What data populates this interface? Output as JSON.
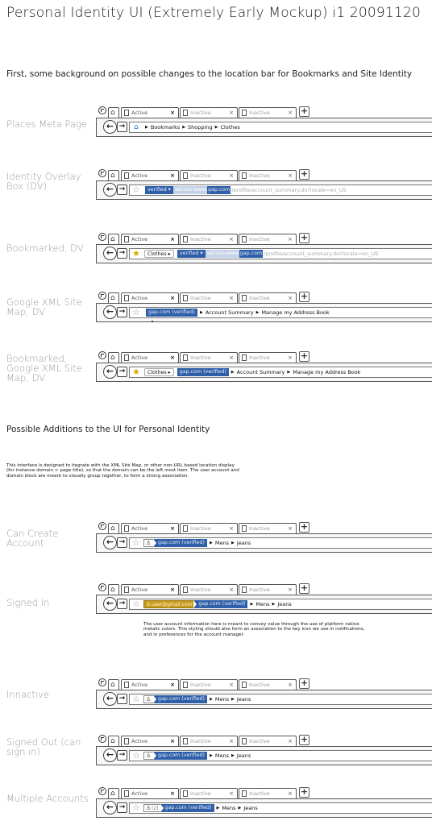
{
  "title": "Personal Identity UI (Extremely Early Mockup) i1 20091120",
  "section1_heading": "First, some background on possible changes to the location bar for Bookmarks and Site Identity",
  "section2_heading": "Possible Additions to the UI for Personal Identity",
  "intro_note": "This interface is designed to itegrate with the XML Site Map, or other non-URL based location display (for instance domain > page title), so that the domain can be the left most item. The user account and domain block are meant to visually group together, to form a strong association.",
  "signed_in_note": "The user account information here is meant to convey value through the use of platform native metalic colors. This styling should also form an association to the key icon we use in notifications, and in preferences for the account manager.",
  "tabs": {
    "active": "Active",
    "inactive": "Inactive",
    "close": "×",
    "new": "+"
  },
  "nav": {
    "back": "←",
    "forward": "→"
  },
  "rows": {
    "places": {
      "label": "Places Meta Page",
      "crumbs": [
        "Bookmarks",
        "Shopping",
        "Clothes"
      ]
    },
    "identity": {
      "label": "Identity Overlay Box (DV)",
      "verified": "verified ▾",
      "domain_prefix": "secure-www.",
      "domain": "gap.com",
      "path": "/profile/account_summary.do?locale=en_US"
    },
    "bookmarked": {
      "label": "Bookmarked, DV",
      "bookmark": "Clothes ▸",
      "verified": "verified ▾",
      "domain_prefix": "secure-www.",
      "domain": "gap.com",
      "path": "/profile/account_summary.do?locale=en_US"
    },
    "sitemap": {
      "label": "Google XML Site Map, DV",
      "site": "gap.com (verified)",
      "crumbs": [
        "Account Summary",
        "Manage my Address Book"
      ]
    },
    "bm_sitemap": {
      "label": "Bookmarked, Google XML Site Map, DV",
      "bookmark": "Clothes ▸",
      "site": "gap.com (verified)",
      "crumbs": [
        "Account Summary",
        "Manage my Address Book"
      ]
    },
    "can_create": {
      "label": "Can Create Account",
      "site": "gap.com (verified)",
      "crumbs": [
        "Mens",
        "Jeans"
      ]
    },
    "signed_in": {
      "label": "Signed In",
      "user": "user@gmail.com",
      "site": "gap.com (verified)",
      "crumbs": [
        "Mens",
        "Jeans"
      ]
    },
    "inactive": {
      "label": "Innactive",
      "site": "gap.com (verified)",
      "crumbs": [
        "Mens",
        "Jeans"
      ]
    },
    "signed_out": {
      "label": "Signed Out (can sign in)",
      "site": "gap.com (verified)",
      "crumbs": [
        "Mens",
        "Jeans"
      ]
    },
    "multiple": {
      "label": "Multiple Accounts",
      "count": "(2)",
      "site": "gap.com (verified)",
      "crumbs": [
        "Mens",
        "Jeans"
      ]
    }
  },
  "icons": {
    "firefox": "firefox-logo-icon",
    "home": "home-icon",
    "page": "page-icon",
    "star": "star-icon",
    "user": "user-icon",
    "places_home": "places-house-icon"
  },
  "colors": {
    "identity_blue": "#2e5fa8",
    "account_gold": "#c99a1a",
    "bookmark_star": "#d9a400",
    "label_gray": "#9a9a9a"
  }
}
